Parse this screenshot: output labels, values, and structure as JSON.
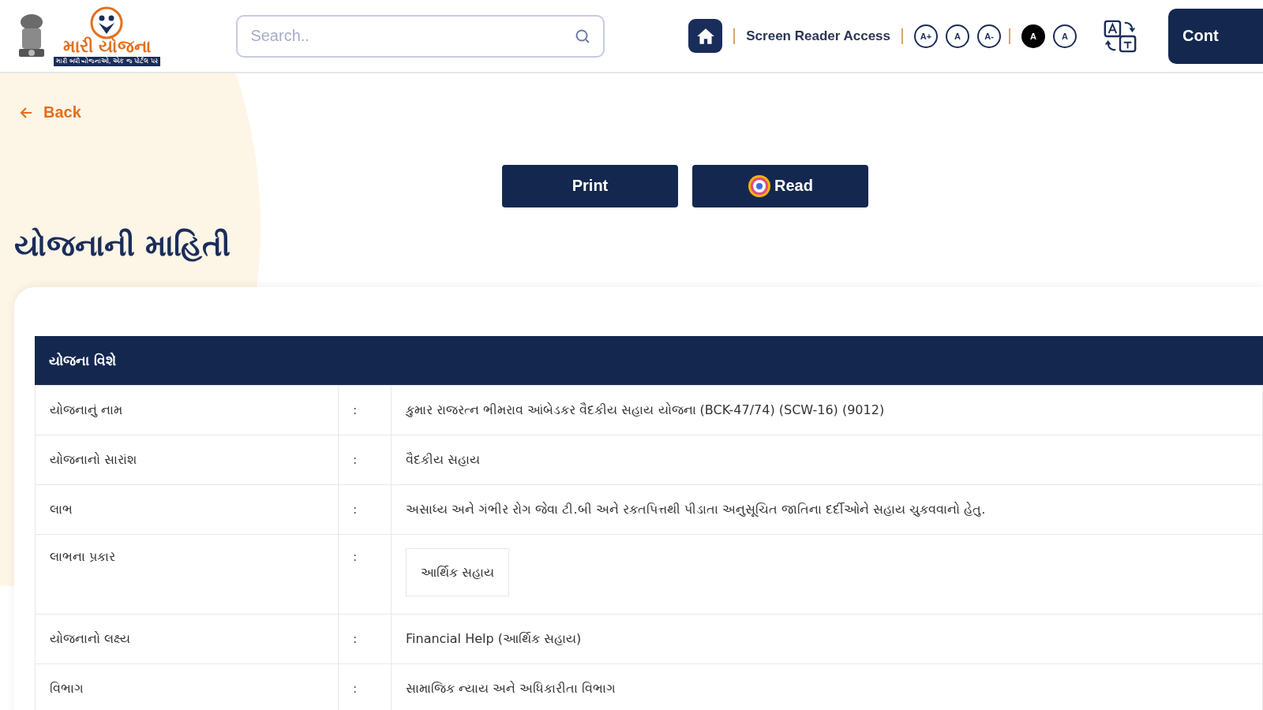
{
  "header": {
    "logo_text": "મારી યોજના",
    "logo_tagline": "મારી બધી યોજનાઓ, એક જ પોર્ટલ પર",
    "search": {
      "placeholder": "Search.."
    },
    "screen_reader": "Screen Reader Access",
    "font_sizes": [
      "A+",
      "A",
      "A-"
    ],
    "contrast": [
      {
        "label": "A",
        "selected": true
      },
      {
        "label": "A",
        "selected": false
      }
    ],
    "contact_button": "Cont"
  },
  "back": "Back",
  "actions": [
    {
      "label": "Print",
      "kind": "plain"
    },
    {
      "label": "Read",
      "kind": "read"
    }
  ],
  "title": "યોજનાની માહિતી",
  "section": {
    "heading": "યોજના વિશે",
    "rows": [
      {
        "label": "યોજનાનું નામ",
        "sep": ":",
        "kind": "text",
        "value": "કુમાર રાજરત્ન ભીમરાવ આંબેડકર વૈદકીય સહાય યોજના (BCK-47/74) (SCW-16) (9012)"
      },
      {
        "label": "યોજનાનો સારાંશ",
        "sep": ":",
        "kind": "text",
        "value": "વૈદકીય સહાય"
      },
      {
        "label": "લાભ",
        "sep": ":",
        "kind": "text",
        "value": "અસાધ્ય અને ગંભીર રોગ જેવા ટી.બી અને રકતપિત્તથી પીડાતા અનુસૂચિત જાતિના દર્દીઓને સહાય ચુકવવાનો હેતુ."
      },
      {
        "label": "લાભના પ્રકાર",
        "sep": ":",
        "kind": "tag",
        "value": "આર્થિક સહાય"
      },
      {
        "label": "યોજનાનો લક્ષ્ય",
        "sep": ":",
        "kind": "text",
        "value": "Financial Help (આર્થિક સહાય)"
      },
      {
        "label": "વિભાગ",
        "sep": ":",
        "kind": "text",
        "value": "સામાજિક ન્યાય અને અધિકારીતા વિભાગ"
      }
    ]
  }
}
